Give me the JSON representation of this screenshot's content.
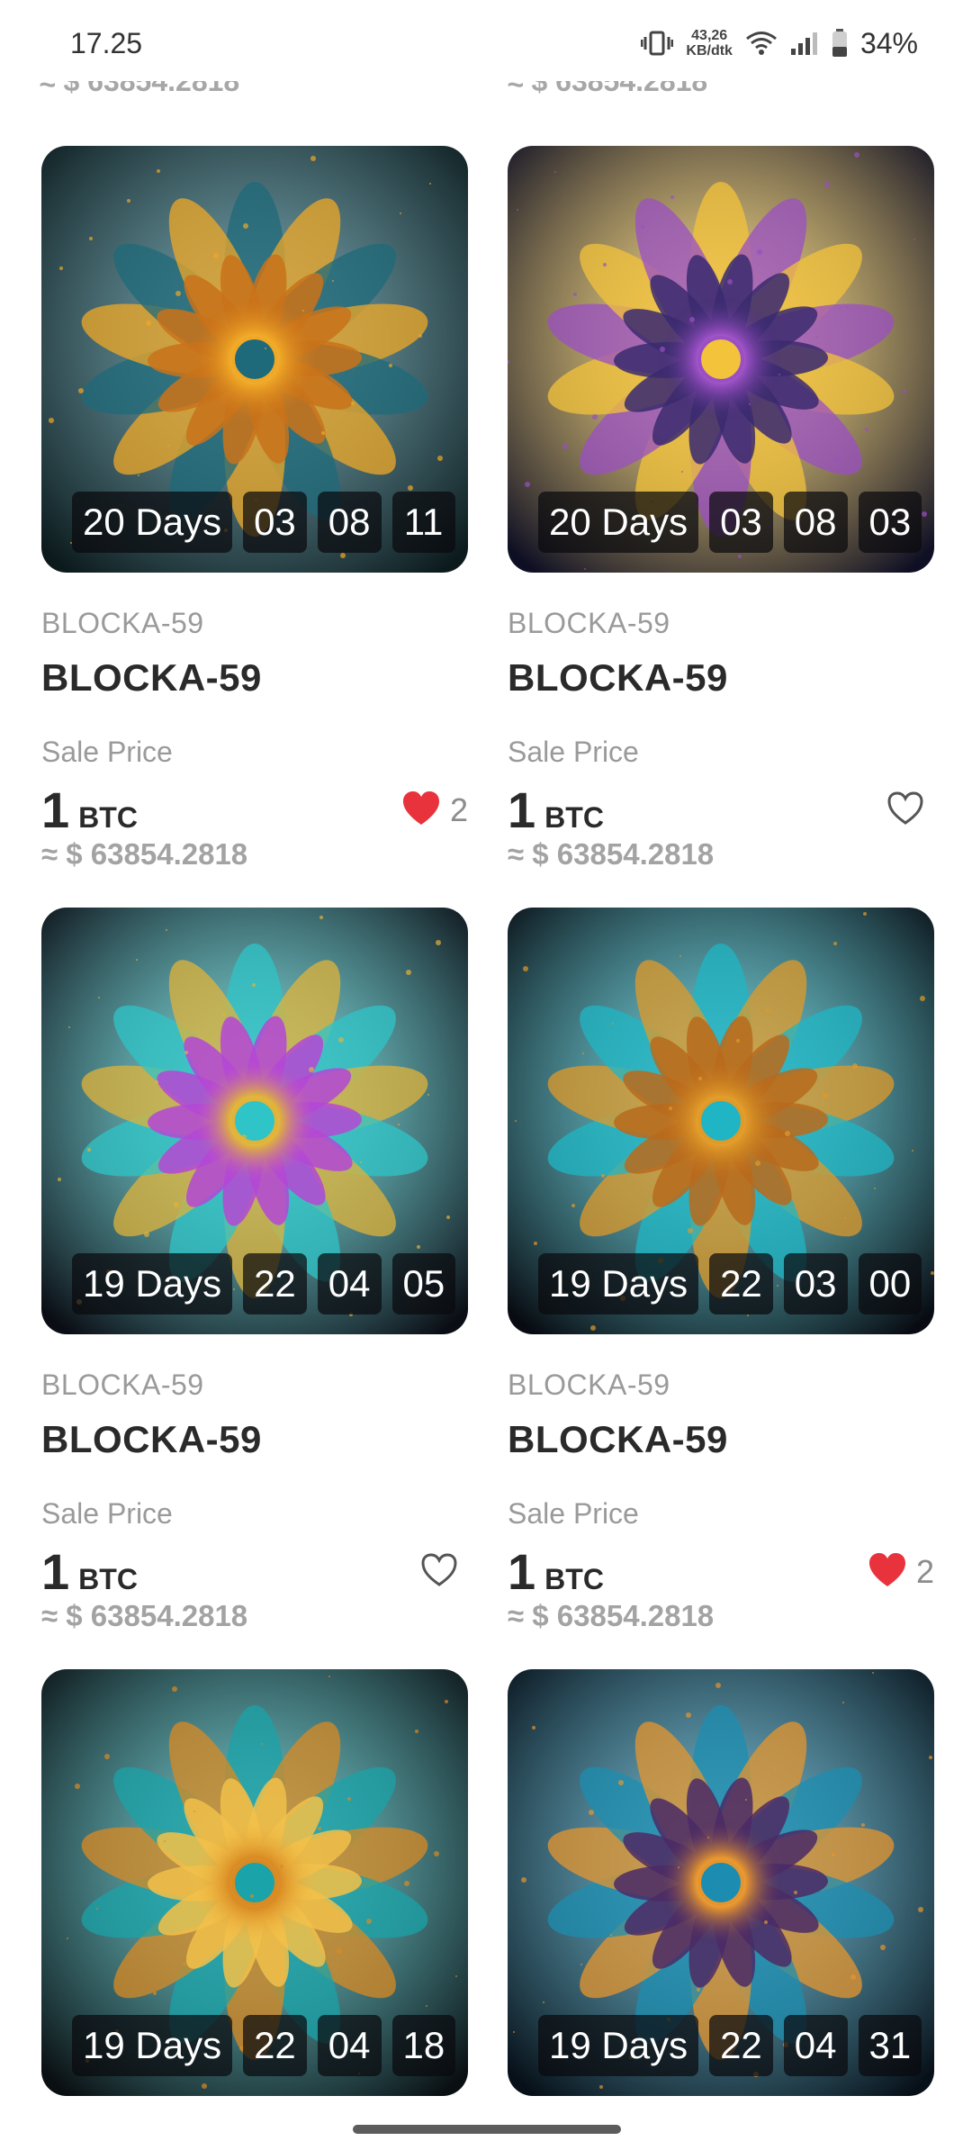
{
  "status_bar": {
    "time": "17.25",
    "net_speed_value": "43,26",
    "net_speed_unit": "KB/dtk",
    "battery": "34%"
  },
  "top_partial": {
    "left_usd": "≈ $ 63854.2818",
    "right_usd": "≈ $ 63854.2818"
  },
  "cards": [
    {
      "timer": [
        "20 Days",
        "03",
        "08",
        "11"
      ],
      "collection": "BLOCKA-59",
      "name": "BLOCKA-59",
      "sale_label": "Sale Price",
      "price": "1",
      "unit": "BTC",
      "usd": "≈ $ 63854.2818",
      "liked": true,
      "likes": "2",
      "palette": [
        "#0c1a1c",
        "#f0a826",
        "#1f6a7a",
        "#c9721a"
      ]
    },
    {
      "timer": [
        "20 Days",
        "03",
        "08",
        "03"
      ],
      "collection": "BLOCKA-59",
      "name": "BLOCKA-59",
      "sale_label": "Sale Price",
      "price": "1",
      "unit": "BTC",
      "usd": "≈ $ 63854.2818",
      "liked": false,
      "likes": "",
      "palette": [
        "#0e0f24",
        "#9a4fc4",
        "#f3c33b",
        "#3a2a6e"
      ]
    },
    {
      "timer": [
        "19 Days",
        "22",
        "04",
        "05"
      ],
      "collection": "BLOCKA-59",
      "name": "BLOCKA-59",
      "sale_label": "Sale Price",
      "price": "1",
      "unit": "BTC",
      "usd": "≈ $ 63854.2818",
      "liked": false,
      "likes": "",
      "palette": [
        "#0b0d14",
        "#e0b33a",
        "#2fc4c7",
        "#b447d6"
      ]
    },
    {
      "timer": [
        "19 Days",
        "22",
        "03",
        "00"
      ],
      "collection": "BLOCKA-59",
      "name": "BLOCKA-59",
      "sale_label": "Sale Price",
      "price": "1",
      "unit": "BTC",
      "usd": "≈ $ 63854.2818",
      "liked": true,
      "likes": "2",
      "palette": [
        "#080c12",
        "#e09a28",
        "#1fb5c4",
        "#b86a1c"
      ]
    },
    {
      "timer": [
        "19 Days",
        "22",
        "04",
        "18"
      ],
      "collection": "",
      "name": "",
      "sale_label": "",
      "price": "",
      "unit": "",
      "usd": "",
      "liked": false,
      "likes": "",
      "palette": [
        "#0a0f12",
        "#d98a22",
        "#1aa3a8",
        "#f2c14a"
      ]
    },
    {
      "timer": [
        "19 Days",
        "22",
        "04",
        "31"
      ],
      "collection": "",
      "name": "",
      "sale_label": "",
      "price": "",
      "unit": "",
      "usd": "",
      "liked": false,
      "likes": "",
      "palette": [
        "#071018",
        "#e6952e",
        "#1c8db0",
        "#4a2a66"
      ]
    }
  ],
  "colors": {
    "heart_filled": "#e8323c",
    "heart_outline": "#555555",
    "muted_text": "#9a9a9a",
    "title_text": "#2a2a2a"
  }
}
